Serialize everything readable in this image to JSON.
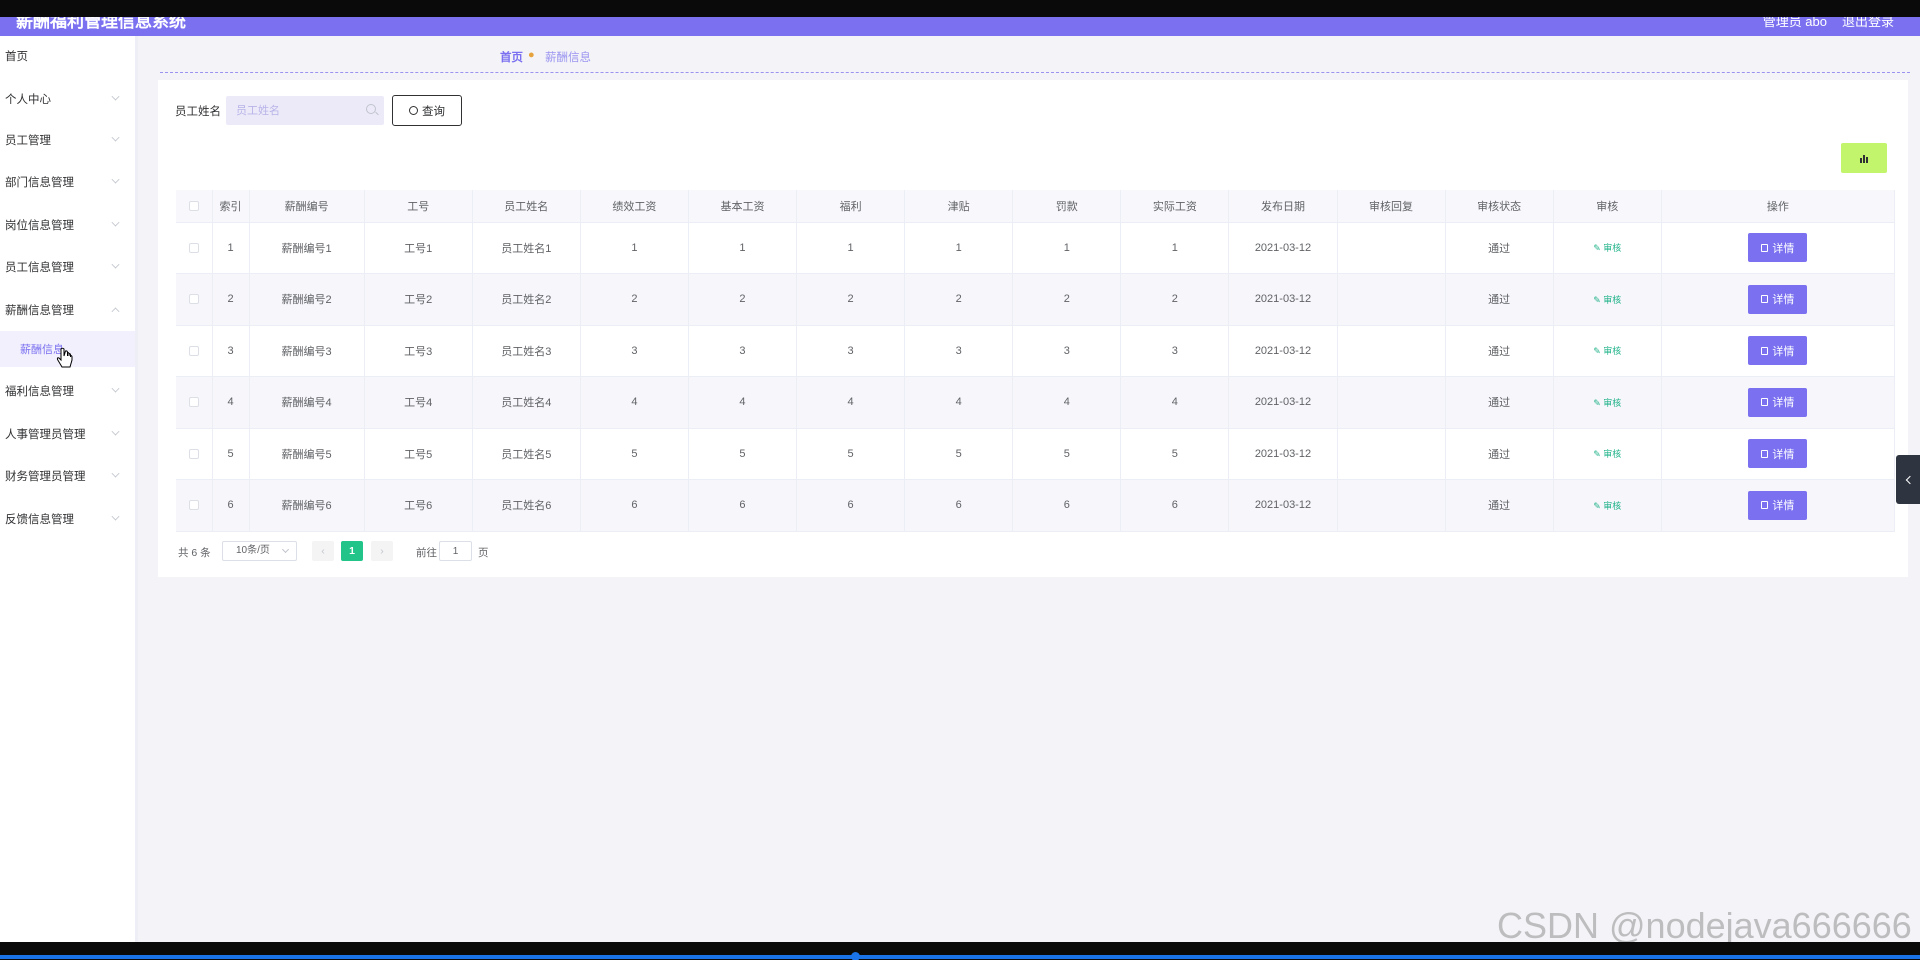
{
  "header": {
    "title": "薪酬福利管理信息系统",
    "admin": "管理员 abo",
    "logout": "退出登录"
  },
  "sidebar": {
    "items": [
      {
        "label": "首页"
      },
      {
        "label": "个人中心"
      },
      {
        "label": "员工管理"
      },
      {
        "label": "部门信息管理"
      },
      {
        "label": "岗位信息管理"
      },
      {
        "label": "员工信息管理"
      },
      {
        "label": "薪酬信息管理"
      },
      {
        "label": "福利信息管理"
      },
      {
        "label": "人事管理员管理"
      },
      {
        "label": "财务管理员管理"
      },
      {
        "label": "反馈信息管理"
      }
    ],
    "sub_item": "薪酬信息"
  },
  "breadcrumb": {
    "home": "首页",
    "current": "薪酬信息"
  },
  "search": {
    "label": "员工姓名",
    "placeholder": "员工姓名",
    "button": "查询"
  },
  "table": {
    "headers": [
      "索引",
      "薪酬编号",
      "工号",
      "员工姓名",
      "绩效工资",
      "基本工资",
      "福利",
      "津贴",
      "罚款",
      "实际工资",
      "发布日期",
      "审核回复",
      "审核状态",
      "审核",
      "操作"
    ],
    "rows": [
      {
        "index": "1",
        "salary_no": "薪酬编号1",
        "emp_no": "工号1",
        "name": "员工姓名1",
        "perf": "1",
        "base": "1",
        "welfare": "1",
        "allowance": "1",
        "fine": "1",
        "actual": "1",
        "date": "2021-03-12",
        "reply": "",
        "status": "通过",
        "audit": "审核",
        "action": "详情"
      },
      {
        "index": "2",
        "salary_no": "薪酬编号2",
        "emp_no": "工号2",
        "name": "员工姓名2",
        "perf": "2",
        "base": "2",
        "welfare": "2",
        "allowance": "2",
        "fine": "2",
        "actual": "2",
        "date": "2021-03-12",
        "reply": "",
        "status": "通过",
        "audit": "审核",
        "action": "详情"
      },
      {
        "index": "3",
        "salary_no": "薪酬编号3",
        "emp_no": "工号3",
        "name": "员工姓名3",
        "perf": "3",
        "base": "3",
        "welfare": "3",
        "allowance": "3",
        "fine": "3",
        "actual": "3",
        "date": "2021-03-12",
        "reply": "",
        "status": "通过",
        "audit": "审核",
        "action": "详情"
      },
      {
        "index": "4",
        "salary_no": "薪酬编号4",
        "emp_no": "工号4",
        "name": "员工姓名4",
        "perf": "4",
        "base": "4",
        "welfare": "4",
        "allowance": "4",
        "fine": "4",
        "actual": "4",
        "date": "2021-03-12",
        "reply": "",
        "status": "通过",
        "audit": "审核",
        "action": "详情"
      },
      {
        "index": "5",
        "salary_no": "薪酬编号5",
        "emp_no": "工号5",
        "name": "员工姓名5",
        "perf": "5",
        "base": "5",
        "welfare": "5",
        "allowance": "5",
        "fine": "5",
        "actual": "5",
        "date": "2021-03-12",
        "reply": "",
        "status": "通过",
        "audit": "审核",
        "action": "详情"
      },
      {
        "index": "6",
        "salary_no": "薪酬编号6",
        "emp_no": "工号6",
        "name": "员工姓名6",
        "perf": "6",
        "base": "6",
        "welfare": "6",
        "allowance": "6",
        "fine": "6",
        "actual": "6",
        "date": "2021-03-12",
        "reply": "",
        "status": "通过",
        "audit": "审核",
        "action": "详情"
      }
    ]
  },
  "pager": {
    "total": "共 6 条",
    "page_size": "10条/页",
    "current_page": "1",
    "goto_label": "前往",
    "goto_value": "1",
    "page_unit": "页"
  },
  "watermark": "CSDN @nodejava666666",
  "icons": {
    "search": "search-icon",
    "chart": "bar-chart-icon",
    "audit": "edit-icon",
    "detail": "document-icon",
    "collapse": "chevron-left-icon"
  },
  "colors": {
    "primary": "#7a70f0",
    "success": "#22c48a",
    "chart_button": "#c2f56c"
  }
}
